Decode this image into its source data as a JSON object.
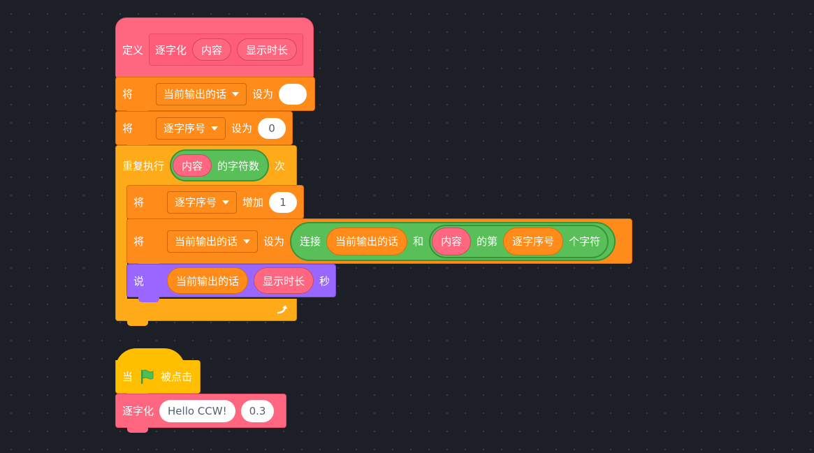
{
  "define": {
    "keyword": "定义",
    "proc_name": "逐字化",
    "arg1": "内容",
    "arg2": "显示时长"
  },
  "set_output": {
    "keyword": "将",
    "variable": "当前输出的话",
    "set_to": "设为",
    "value": ""
  },
  "set_index": {
    "keyword": "将",
    "variable": "逐字序号",
    "set_to": "设为",
    "value": "0"
  },
  "repeat": {
    "label": "重复执行",
    "arg": "内容",
    "length_of": "的字符数",
    "times": "次",
    "loop_icon": "loop-arrow-icon"
  },
  "change_index": {
    "keyword": "将",
    "variable": "逐字序号",
    "change_by": "增加",
    "value": "1"
  },
  "set_join": {
    "keyword": "将",
    "variable": "当前输出的话",
    "set_to": "设为",
    "join_label": "连接",
    "join_arg1": "当前输出的话",
    "and_label": "和",
    "letter_arg_text": "内容",
    "letter_of": "的第",
    "letter_index": "逐字序号",
    "letter_unit": "个字符"
  },
  "say": {
    "keyword": "说",
    "arg1": "当前输出的话",
    "arg2": "显示时长",
    "seconds": "秒"
  },
  "hat": {
    "when": "当",
    "flag_icon": "green-flag-icon",
    "clicked": "被点击"
  },
  "call": {
    "proc_name": "逐字化",
    "arg1": "Hello CCW!",
    "arg2": "0.3"
  },
  "colors": {
    "background": "#1c1f26",
    "my_blocks": "#ff6680",
    "variables": "#ff8c1a",
    "control": "#ffab19",
    "looks": "#9966ff",
    "operators": "#59c059",
    "events": "#ffbf00"
  }
}
